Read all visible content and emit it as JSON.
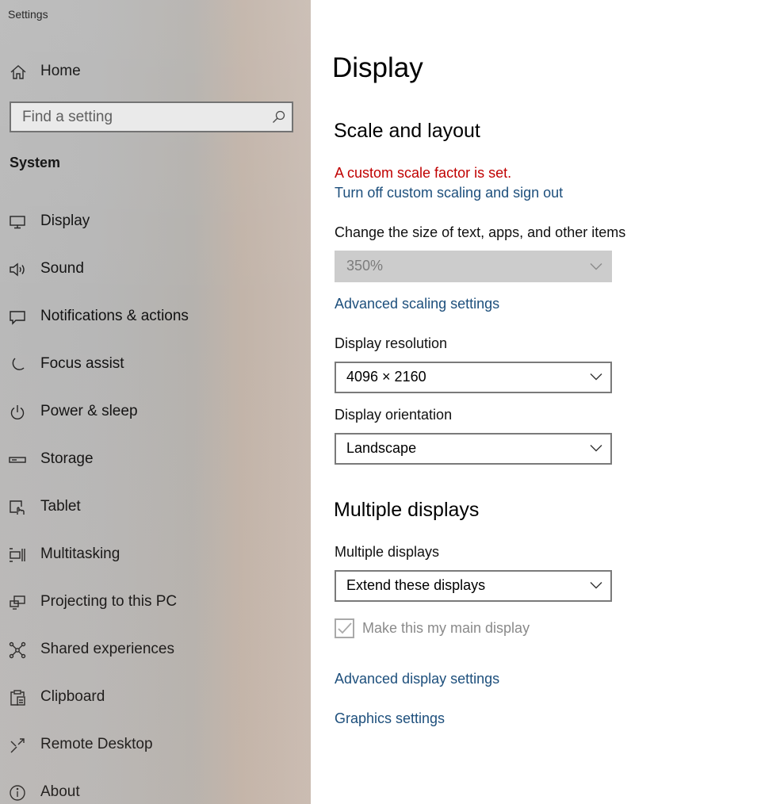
{
  "window": {
    "title": "Settings"
  },
  "sidebar": {
    "home": {
      "label": "Home",
      "icon": "home-icon"
    },
    "search": {
      "placeholder": "Find a setting",
      "icon": "search-icon"
    },
    "section": "System",
    "items": [
      {
        "label": "Display",
        "icon": "display-icon",
        "selected": true
      },
      {
        "label": "Sound",
        "icon": "speaker-icon"
      },
      {
        "label": "Notifications & actions",
        "icon": "notification-icon"
      },
      {
        "label": "Focus assist",
        "icon": "moon-icon"
      },
      {
        "label": "Power & sleep",
        "icon": "power-icon"
      },
      {
        "label": "Storage",
        "icon": "storage-icon"
      },
      {
        "label": "Tablet",
        "icon": "tablet-icon"
      },
      {
        "label": "Multitasking",
        "icon": "multitasking-icon"
      },
      {
        "label": "Projecting to this PC",
        "icon": "projecting-icon"
      },
      {
        "label": "Shared experiences",
        "icon": "shared-experiences-icon"
      },
      {
        "label": "Clipboard",
        "icon": "clipboard-icon"
      },
      {
        "label": "Remote Desktop",
        "icon": "remote-desktop-icon"
      },
      {
        "label": "About",
        "icon": "info-icon"
      }
    ]
  },
  "main": {
    "title": "Display",
    "scale_layout": {
      "heading": "Scale and layout",
      "warning": "A custom scale factor is set.",
      "turn_off_link": "Turn off custom scaling and sign out",
      "size_label": "Change the size of text, apps, and other items",
      "size_value": "350%",
      "advanced_scaling_link": "Advanced scaling settings",
      "resolution_label": "Display resolution",
      "resolution_value": "4096 × 2160",
      "orientation_label": "Display orientation",
      "orientation_value": "Landscape"
    },
    "multiple_displays": {
      "heading": "Multiple displays",
      "label": "Multiple displays",
      "value": "Extend these displays",
      "main_display_checkbox": "Make this my main display",
      "main_display_checked": true,
      "advanced_display_link": "Advanced display settings",
      "graphics_link": "Graphics settings"
    }
  },
  "colors": {
    "warning": "#c00000",
    "link": "#1d4f7c",
    "disabled_fill": "#cccccc"
  }
}
